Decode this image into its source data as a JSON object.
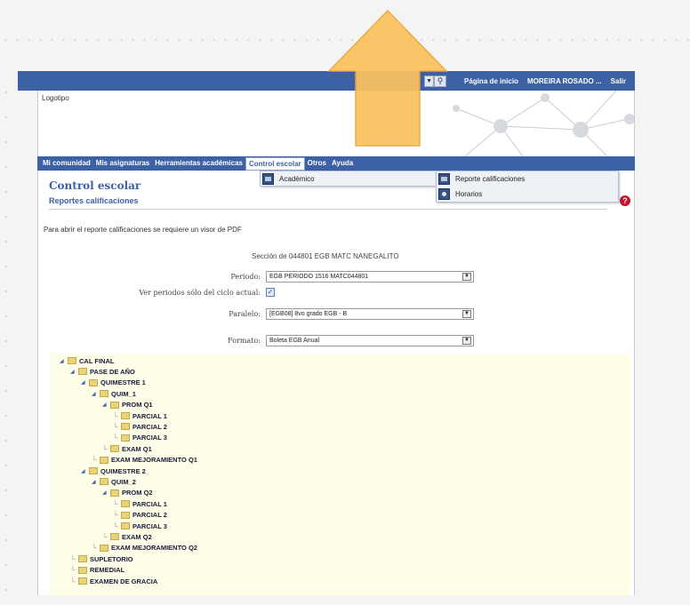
{
  "topbar": {
    "home_link": "Página de inicio",
    "user_name": "MOREIRA ROSADO ...",
    "logout": "Salir"
  },
  "banner": {
    "logo_text": "Logotipo"
  },
  "menu": {
    "items": [
      "Mi comunidad",
      "Mis asignaturas",
      "Herramientas académicas",
      "Control escolar",
      "Otros",
      "Ayuda"
    ],
    "active_index": 3
  },
  "submenu": {
    "level1": {
      "label": "Académico",
      "icon": "folder-icon"
    },
    "level2": [
      {
        "label": "Reporte calificaciones",
        "icon": "folder-icon"
      },
      {
        "label": "Horarios",
        "icon": "bullet-icon"
      }
    ]
  },
  "page": {
    "title": "Control escolar",
    "subtitle": "Reportes calificaciones",
    "pdf_note": "Para abrir el reporte calificaciones se requiere un visor de PDF",
    "section": "Sección de 044801 EGB MATC NANEGALITO"
  },
  "form": {
    "periodo_label": "Periodo:",
    "periodo_value": "EGB PERIODO 1516 MATC044801",
    "ciclo_label": "Ver periodos sólo del ciclo actual:",
    "ciclo_checked": true,
    "paralelo_label": "Paralelo:",
    "paralelo_value": "[EGB08] 8vo grado EGB - B",
    "formato_label": "Formato:",
    "formato_value": "Boleta EGB Anual"
  },
  "tree": [
    {
      "label": "CAL FINAL",
      "level": 0,
      "expanded": true
    },
    {
      "label": "PASE DE AÑO",
      "level": 1,
      "expanded": true
    },
    {
      "label": "QUIMESTRE 1",
      "level": 2,
      "expanded": true
    },
    {
      "label": "QUIM_1",
      "level": 3,
      "expanded": true
    },
    {
      "label": "PROM Q1",
      "level": 4,
      "expanded": true
    },
    {
      "label": "PARCIAL 1",
      "level": 5,
      "expanded": false
    },
    {
      "label": "PARCIAL 2",
      "level": 5,
      "expanded": false
    },
    {
      "label": "PARCIAL 3",
      "level": 5,
      "expanded": false
    },
    {
      "label": "EXAM Q1",
      "level": 4,
      "expanded": false
    },
    {
      "label": "EXAM MEJORAMIENTO Q1",
      "level": 3,
      "expanded": false
    },
    {
      "label": "QUIMESTRE 2",
      "level": 2,
      "expanded": true
    },
    {
      "label": "QUIM_2",
      "level": 3,
      "expanded": true
    },
    {
      "label": "PROM Q2",
      "level": 4,
      "expanded": true
    },
    {
      "label": "PARCIAL 1",
      "level": 5,
      "expanded": false
    },
    {
      "label": "PARCIAL 2",
      "level": 5,
      "expanded": false
    },
    {
      "label": "PARCIAL 3",
      "level": 5,
      "expanded": false
    },
    {
      "label": "EXAM Q2",
      "level": 4,
      "expanded": false
    },
    {
      "label": "EXAM MEJORAMIENTO Q2",
      "level": 3,
      "expanded": false
    },
    {
      "label": "SUPLETORIO",
      "level": 1,
      "expanded": false
    },
    {
      "label": "REMEDIAL",
      "level": 1,
      "expanded": false
    },
    {
      "label": "EXAMEN DE GRACIA",
      "level": 1,
      "expanded": false
    }
  ],
  "colors": {
    "brand_blue": "#3c61a5",
    "tree_background": "#fefee8",
    "arrow_fill": "#fbc25e",
    "help_red": "#c8102e"
  }
}
